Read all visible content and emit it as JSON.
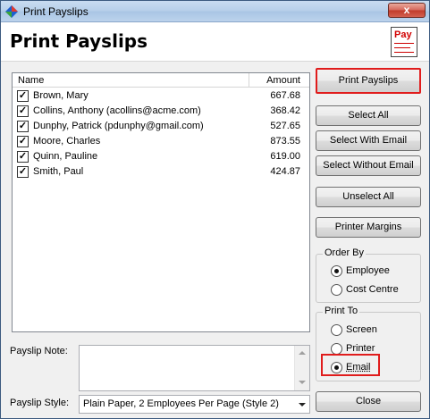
{
  "window": {
    "title": "Print Payslips",
    "close_glyph": "x"
  },
  "header": {
    "title": "Print Payslips",
    "icon_text": "Pay"
  },
  "list": {
    "columns": [
      "Name",
      "Amount"
    ],
    "rows": [
      {
        "checked": true,
        "name": "Brown, Mary",
        "amount": "667.68"
      },
      {
        "checked": true,
        "name": "Collins, Anthony (acollins@acme.com)",
        "amount": "368.42"
      },
      {
        "checked": true,
        "name": "Dunphy, Patrick (pdunphy@gmail.com)",
        "amount": "527.65"
      },
      {
        "checked": true,
        "name": "Moore, Charles",
        "amount": "873.55"
      },
      {
        "checked": true,
        "name": "Quinn, Pauline",
        "amount": "619.00"
      },
      {
        "checked": true,
        "name": "Smith, Paul",
        "amount": "424.87"
      }
    ]
  },
  "buttons": {
    "print_payslips": "Print Payslips",
    "select_all": "Select All",
    "select_with_email": "Select With Email",
    "select_without_email": "Select Without Email",
    "unselect_all": "Unselect All",
    "printer_margins": "Printer Margins",
    "close": "Close"
  },
  "order_by": {
    "label": "Order By",
    "options": [
      "Employee",
      "Cost Centre"
    ],
    "selected": "Employee"
  },
  "print_to": {
    "label": "Print To",
    "options": [
      "Screen",
      "Printer",
      "Email"
    ],
    "selected": "Email"
  },
  "payslip_note": {
    "label": "Payslip Note:",
    "value": ""
  },
  "payslip_style": {
    "label": "Payslip Style:",
    "value": "Plain Paper, 2 Employees Per Page (Style 2)"
  },
  "colors": {
    "highlight_border": "#e01c1c",
    "pay_icon_red": "#d10000"
  }
}
